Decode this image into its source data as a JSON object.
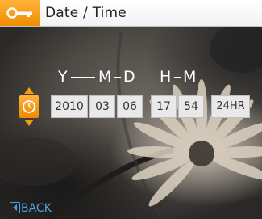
{
  "header": {
    "title": "Date / Time",
    "icon": "wrench-icon"
  },
  "labels": {
    "year": "Y",
    "month": "M",
    "day": "D",
    "hour": "H",
    "minute": "M"
  },
  "fields": {
    "year": "2010",
    "month": "03",
    "day": "06",
    "hour": "17",
    "minute": "54",
    "format": "24HR"
  },
  "back_label": "BACK",
  "colors": {
    "accent": "#f39b12",
    "back": "#4aa0e0"
  }
}
